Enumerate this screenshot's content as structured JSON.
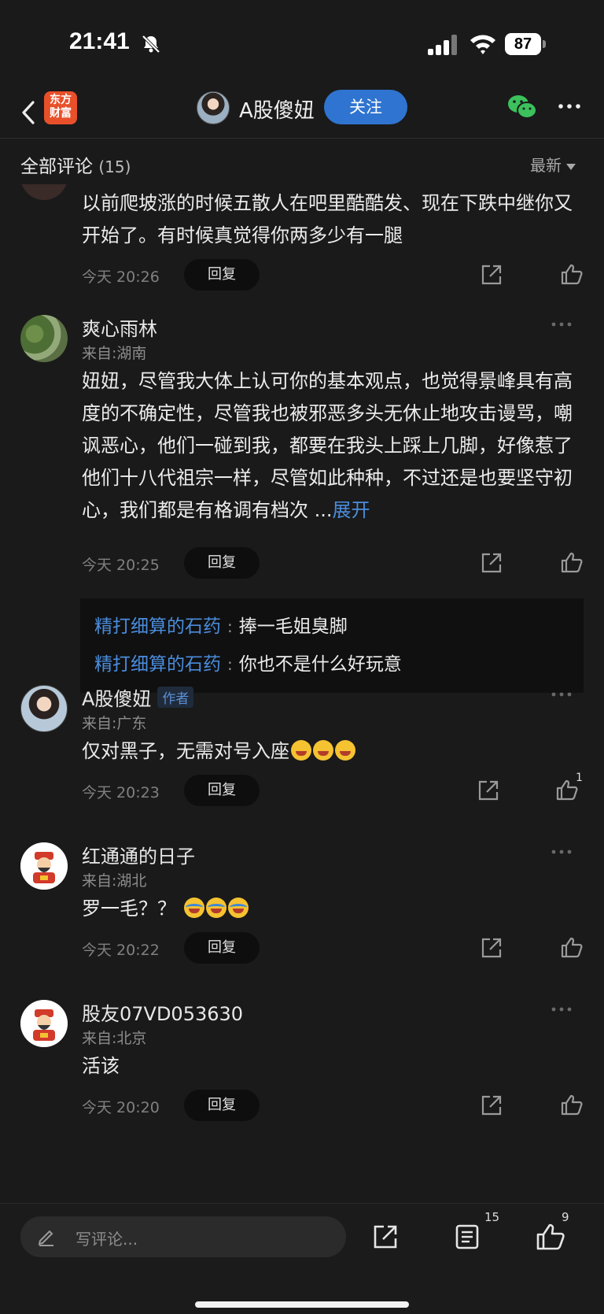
{
  "status_bar": {
    "time": "21:41",
    "battery": "87"
  },
  "nav": {
    "app_logo_line1": "东方",
    "app_logo_line2": "财富",
    "author_name": "A股傻妞",
    "follow_label": "关注"
  },
  "comment_header": {
    "title": "全部评论",
    "count": "(15)",
    "sort_label": "最新"
  },
  "comments": [
    {
      "body": "以前爬坡涨的时候五散人在吧里酷酷发、现在下跌中继你又开始了。有时候真觉得你两多少有一腿",
      "time": "今天 20:26",
      "reply_label": "回复"
    },
    {
      "name": "爽心雨林",
      "location": "来自:湖南",
      "body": "妞妞，尽管我大体上认可你的基本观点，也觉得景峰具有高度的不确定性，尽管我也被邪恶多头无休止地攻击谩骂，嘲讽恶心，他们一碰到我，都要在我头上踩上几脚，好像惹了他们十八代祖宗一样，尽管如此种种，不过还是也要坚守初心，我们都是有格调有档次 ...",
      "expand": "展开",
      "time": "今天 20:25",
      "reply_label": "回复",
      "replies": [
        {
          "user": "精打细算的石药",
          "sep": ":",
          "text": "捧一毛姐臭脚"
        },
        {
          "user": "精打细算的石药",
          "sep": ":",
          "text": "你也不是什么好玩意"
        }
      ]
    },
    {
      "name": "A股傻妞",
      "tag": "作者",
      "location": "来自:广东",
      "body": "仅对黑子，无需对号入座",
      "time": "今天 20:23",
      "reply_label": "回复",
      "likes": "1"
    },
    {
      "name": "红通通的日子",
      "location": "来自:湖北",
      "body": "罗一毛？？",
      "time": "今天 20:22",
      "reply_label": "回复"
    },
    {
      "name": "股友07VD053630",
      "location": "来自:北京",
      "body": "活该",
      "time": "今天 20:20",
      "reply_label": "回复"
    }
  ],
  "bottom_bar": {
    "placeholder": "写评论...",
    "comment_count": "15",
    "like_count": "9"
  },
  "colors": {
    "accent": "#2f74d0",
    "link": "#4a8ddc",
    "background": "#1a1a1b",
    "logo": "#e8502a"
  }
}
